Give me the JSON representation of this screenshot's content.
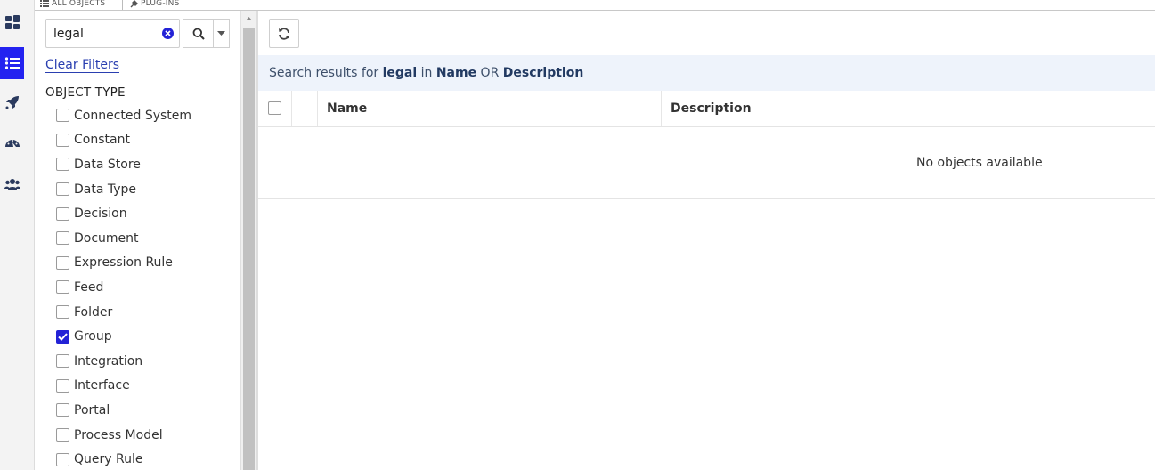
{
  "tabs": [
    {
      "label": "ALL OBJECTS",
      "icon": "list-icon"
    },
    {
      "label": "PLUG-INS",
      "icon": "plug-icon"
    }
  ],
  "rail": [
    {
      "icon": "dashboard-icon",
      "active": false
    },
    {
      "icon": "list-icon",
      "active": true
    },
    {
      "icon": "rocket-icon",
      "active": false
    },
    {
      "icon": "gauge-icon",
      "active": false
    },
    {
      "icon": "users-icon",
      "active": false
    }
  ],
  "filters": {
    "search_value": "legal",
    "clear_filters_label": "Clear Filters",
    "object_type_heading": "OBJECT TYPE",
    "object_types": [
      {
        "label": "Connected System",
        "checked": false
      },
      {
        "label": "Constant",
        "checked": false
      },
      {
        "label": "Data Store",
        "checked": false
      },
      {
        "label": "Data Type",
        "checked": false
      },
      {
        "label": "Decision",
        "checked": false
      },
      {
        "label": "Document",
        "checked": false
      },
      {
        "label": "Expression Rule",
        "checked": false
      },
      {
        "label": "Feed",
        "checked": false
      },
      {
        "label": "Folder",
        "checked": false
      },
      {
        "label": "Group",
        "checked": true
      },
      {
        "label": "Integration",
        "checked": false
      },
      {
        "label": "Interface",
        "checked": false
      },
      {
        "label": "Portal",
        "checked": false
      },
      {
        "label": "Process Model",
        "checked": false
      },
      {
        "label": "Query Rule",
        "checked": false
      }
    ]
  },
  "results": {
    "prefix": "Search results for ",
    "term": "legal",
    "in_text": " in ",
    "field1": "Name",
    "or_text": " OR ",
    "field2": "Description"
  },
  "table": {
    "columns": [
      "Name",
      "Description"
    ],
    "empty_message": "No objects available"
  },
  "colors": {
    "accent": "#2322f0",
    "results_bg": "#eef3fb"
  }
}
